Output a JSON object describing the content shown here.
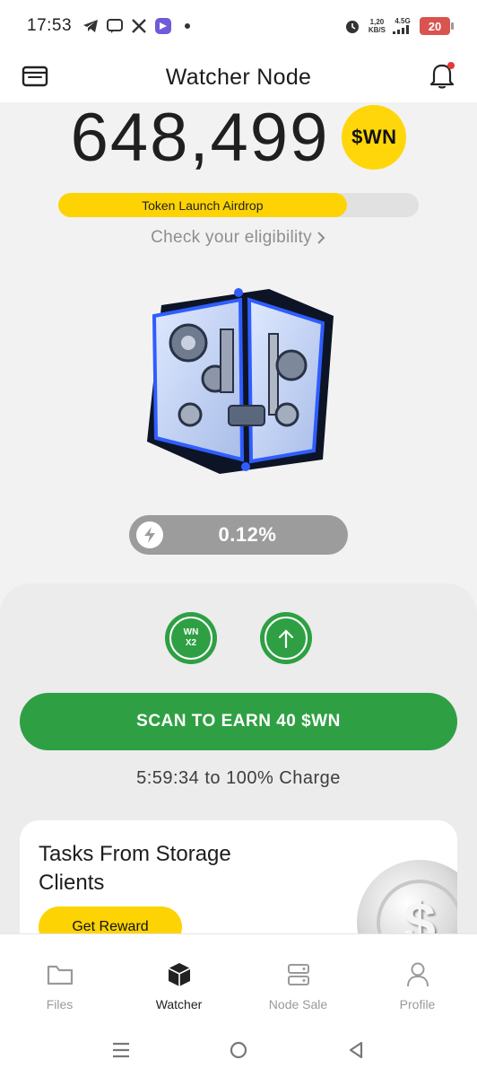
{
  "status_bar": {
    "time": "17:53",
    "net_speed_value": "1,20",
    "net_speed_unit": "KB/S",
    "network_type": "4.5G",
    "battery": "20"
  },
  "header": {
    "title": "Watcher Node"
  },
  "balance": {
    "amount": "648,499",
    "token_badge": "$WN"
  },
  "airdrop": {
    "label": "Token Launch Airdrop",
    "progress_fraction": 0.8,
    "eligibility_link": "Check your eligibility"
  },
  "charge": {
    "percent_text": "0.12%",
    "time_to_full": "5:59:34 to 100% Charge"
  },
  "actions": {
    "multiplier_line1": "WN",
    "multiplier_line2": "X2",
    "scan_button": "SCAN TO EARN 40 $WN"
  },
  "task_card": {
    "title": "Tasks From Storage Clients",
    "button": "Get Reward",
    "coin_symbol": "$"
  },
  "bottom_nav": {
    "items": [
      {
        "label": "Files",
        "icon": "folder-icon",
        "active": false
      },
      {
        "label": "Watcher",
        "icon": "cube-icon",
        "active": true
      },
      {
        "label": "Node Sale",
        "icon": "server-icon",
        "active": false
      },
      {
        "label": "Profile",
        "icon": "user-icon",
        "active": false
      }
    ]
  },
  "colors": {
    "accent_green": "#2ea043",
    "accent_yellow": "#fdd303",
    "notification_dot": "#e53935"
  }
}
